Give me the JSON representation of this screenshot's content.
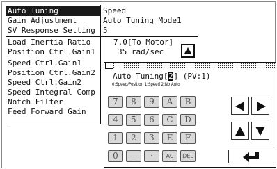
{
  "menu": {
    "items": [
      {
        "label": "Auto Tuning",
        "value": "Speed"
      },
      {
        "label": "Gain Adjustment",
        "value": "Auto Tuning Mode1"
      },
      {
        "label": "SV Response Setting",
        "value": "5"
      },
      {
        "label": "Load Inertia Ratio",
        "value": "7.0[To Motor]"
      },
      {
        "label": "Position Ctrl.Gain1",
        "value": "35 rad/sec"
      },
      {
        "label": "Speed Ctrl.Gain1",
        "value": ""
      },
      {
        "label": "Position Ctrl.Gain2",
        "value": ""
      },
      {
        "label": "Speed Ctrl.Gain2",
        "value": ""
      },
      {
        "label": "Speed Integral Comp",
        "value": ""
      },
      {
        "label": "Notch Filter",
        "value": ""
      },
      {
        "label": "Feed Forward Gain",
        "value": ""
      }
    ],
    "selected_index": 0
  },
  "dialog": {
    "prompt_prefix": "Auto Tuning[",
    "current_digit": "2",
    "prompt_suffix": "] (PV:1)",
    "hint": "0:Speed/Position 1:Speed 2:No Auto",
    "keys": [
      [
        "7",
        "8",
        "9",
        "A",
        "B"
      ],
      [
        "4",
        "5",
        "6",
        "C",
        "D"
      ],
      [
        "1",
        "2",
        "3",
        "E",
        "F"
      ],
      [
        "0",
        "—",
        "·",
        "AC",
        "DEL"
      ]
    ],
    "nav_icons": [
      "arrow-left-icon",
      "arrow-right-icon",
      "arrow-up-icon",
      "arrow-down-icon",
      "enter-icon"
    ]
  },
  "colors": {
    "ink": "#111111",
    "key_fill": "#d9d9d9",
    "key_text": "#555555"
  }
}
